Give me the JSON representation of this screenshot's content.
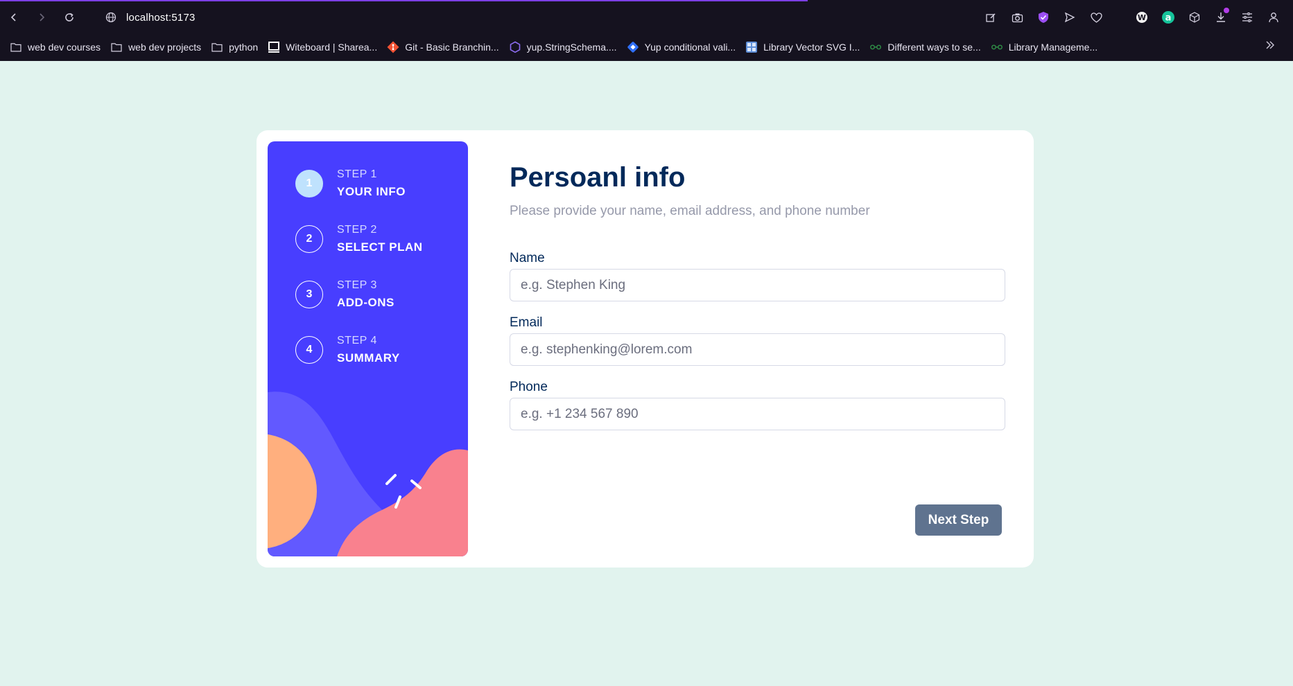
{
  "browser": {
    "url": "localhost:5173",
    "bookmarks": [
      {
        "label": "web dev courses",
        "icon": "folder-icon"
      },
      {
        "label": "web dev projects",
        "icon": "folder-icon"
      },
      {
        "label": "python",
        "icon": "folder-icon"
      },
      {
        "label": "Witeboard | Sharea...",
        "icon": "witeboard-icon"
      },
      {
        "label": "Git - Basic Branchin...",
        "icon": "git-icon"
      },
      {
        "label": "yup.StringSchema....",
        "icon": "yup-icon"
      },
      {
        "label": "Yup conditional vali...",
        "icon": "diamond-icon"
      },
      {
        "label": "Library Vector SVG I...",
        "icon": "svgrepo-icon"
      },
      {
        "label": "Different ways to se...",
        "icon": "gfg-icon"
      },
      {
        "label": "Library Manageme...",
        "icon": "gfg-icon"
      }
    ],
    "colors": {
      "accent": "#7b3fe4",
      "chrome_bg": "#15121f"
    }
  },
  "sidebar": {
    "steps": [
      {
        "number": "1",
        "label": "STEP 1",
        "title": "YOUR INFO",
        "active": true
      },
      {
        "number": "2",
        "label": "STEP 2",
        "title": "SELECT PLAN",
        "active": false
      },
      {
        "number": "3",
        "label": "STEP 3",
        "title": "ADD-ONS",
        "active": false
      },
      {
        "number": "4",
        "label": "STEP 4",
        "title": "SUMMARY",
        "active": false
      }
    ],
    "colors": {
      "background": "#483eff",
      "active_step": "#bfe2fd"
    }
  },
  "form": {
    "title": "Persoanl info",
    "subtitle": "Please provide your name, email address, and phone number",
    "fields": {
      "name": {
        "label": "Name",
        "placeholder": "e.g. Stephen King",
        "value": ""
      },
      "email": {
        "label": "Email",
        "placeholder": "e.g. stephenking@lorem.com",
        "value": ""
      },
      "phone": {
        "label": "Phone",
        "placeholder": "e.g. +1 234 567 890",
        "value": ""
      }
    },
    "next_button": "Next Step",
    "colors": {
      "title": "#02295a",
      "button": "#5f738f"
    }
  }
}
